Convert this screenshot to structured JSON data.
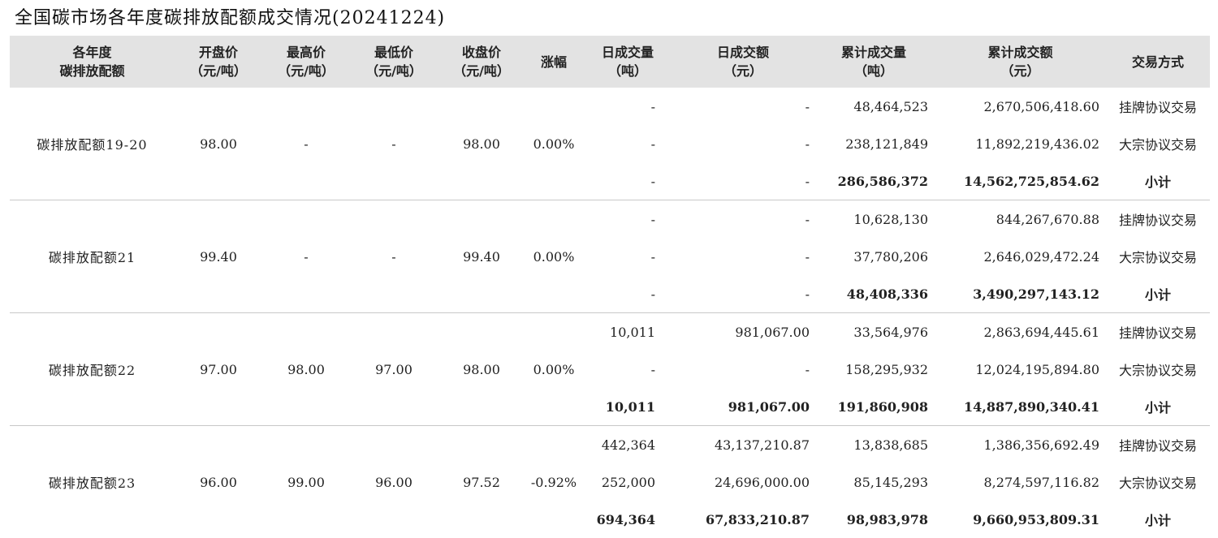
{
  "title": "全国碳市场各年度碳排放配额成交情况(20241224)",
  "header": [
    {
      "line1": "各年度",
      "line2": "碳排放配额"
    },
    {
      "line1": "开盘价",
      "line2": "（元/吨）"
    },
    {
      "line1": "最高价",
      "line2": "（元/吨）"
    },
    {
      "line1": "最低价",
      "line2": "（元/吨）"
    },
    {
      "line1": "收盘价",
      "line2": "（元/吨）"
    },
    {
      "line1": "涨幅",
      "line2": ""
    },
    {
      "line1": "日成交量",
      "line2": "（吨）"
    },
    {
      "line1": "日成交额",
      "line2": "（元）"
    },
    {
      "line1": "累计成交量",
      "line2": "（吨）"
    },
    {
      "line1": "累计成交额",
      "line2": "（元）"
    },
    {
      "line1": "交易方式",
      "line2": ""
    }
  ],
  "groups": [
    {
      "name": "碳排放配额19-20",
      "open": "98.00",
      "high": "-",
      "low": "-",
      "close": "98.00",
      "change": "0.00%",
      "rows": [
        {
          "day_vol": "-",
          "day_amt": "-",
          "cum_vol": "48,464,523",
          "cum_amt": "2,670,506,418.60",
          "method": "挂牌协议交易"
        },
        {
          "day_vol": "-",
          "day_amt": "-",
          "cum_vol": "238,121,849",
          "cum_amt": "11,892,219,436.02",
          "method": "大宗协议交易"
        },
        {
          "day_vol": "-",
          "day_amt": "-",
          "cum_vol": "286,586,372",
          "cum_amt": "14,562,725,854.62",
          "method": "小计"
        }
      ]
    },
    {
      "name": "碳排放配额21",
      "open": "99.40",
      "high": "-",
      "low": "-",
      "close": "99.40",
      "change": "0.00%",
      "rows": [
        {
          "day_vol": "-",
          "day_amt": "-",
          "cum_vol": "10,628,130",
          "cum_amt": "844,267,670.88",
          "method": "挂牌协议交易"
        },
        {
          "day_vol": "-",
          "day_amt": "-",
          "cum_vol": "37,780,206",
          "cum_amt": "2,646,029,472.24",
          "method": "大宗协议交易"
        },
        {
          "day_vol": "-",
          "day_amt": "-",
          "cum_vol": "48,408,336",
          "cum_amt": "3,490,297,143.12",
          "method": "小计"
        }
      ]
    },
    {
      "name": "碳排放配额22",
      "open": "97.00",
      "high": "98.00",
      "low": "97.00",
      "close": "98.00",
      "change": "0.00%",
      "rows": [
        {
          "day_vol": "10,011",
          "day_amt": "981,067.00",
          "cum_vol": "33,564,976",
          "cum_amt": "2,863,694,445.61",
          "method": "挂牌协议交易"
        },
        {
          "day_vol": "-",
          "day_amt": "-",
          "cum_vol": "158,295,932",
          "cum_amt": "12,024,195,894.80",
          "method": "大宗协议交易"
        },
        {
          "day_vol": "10,011",
          "day_amt": "981,067.00",
          "cum_vol": "191,860,908",
          "cum_amt": "14,887,890,340.41",
          "method": "小计"
        }
      ]
    },
    {
      "name": "碳排放配额23",
      "open": "96.00",
      "high": "99.00",
      "low": "96.00",
      "close": "97.52",
      "change": "-0.92%",
      "rows": [
        {
          "day_vol": "442,364",
          "day_amt": "43,137,210.87",
          "cum_vol": "13,838,685",
          "cum_amt": "1,386,356,692.49",
          "method": "挂牌协议交易"
        },
        {
          "day_vol": "252,000",
          "day_amt": "24,696,000.00",
          "cum_vol": "85,145,293",
          "cum_amt": "8,274,597,116.82",
          "method": "大宗协议交易"
        },
        {
          "day_vol": "694,364",
          "day_amt": "67,833,210.87",
          "cum_vol": "98,983,978",
          "cum_amt": "9,660,953,809.31",
          "method": "小计"
        }
      ]
    }
  ]
}
